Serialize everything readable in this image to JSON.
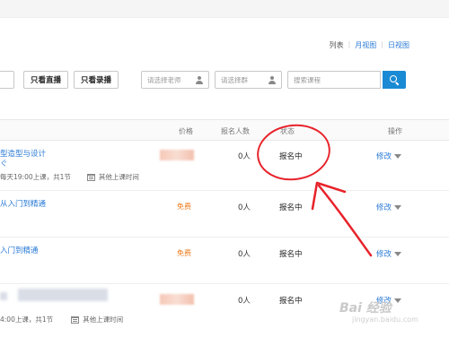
{
  "view": {
    "list": "列表",
    "month": "月视图",
    "day": "日视图"
  },
  "filters": {
    "edge_label": "",
    "live_only": "只看直播",
    "recorded_only": "只看录播",
    "teacher_placeholder": "请选择老师",
    "group_placeholder": "请选择群",
    "search_placeholder": "搜索课程"
  },
  "table": {
    "headers": {
      "price": "价格",
      "enrolled": "报名人数",
      "status": "状态",
      "actions": "操作"
    },
    "rows": [
      {
        "title": "型造型与设计",
        "title_tail": "ぐ",
        "schedule": "每天19:00上课，共1节",
        "other_time": "其他上课时间",
        "price": "",
        "count": "0人",
        "status": "报名中",
        "action": "修改"
      },
      {
        "title": "从入门到精通",
        "price": "免费",
        "count": "0人",
        "status": "报名中",
        "action": "修改"
      },
      {
        "title": "入门到精通",
        "price": "免费",
        "count": "0人",
        "status": "报名中",
        "action": "修改"
      },
      {
        "title": "",
        "schedule": "4:00上课，共1节",
        "other_time": "其他上课时间",
        "price": "",
        "count": "0人",
        "status": "报名中",
        "action": "修改"
      }
    ]
  },
  "watermark": {
    "logo": "Bai 经验",
    "url": "jingyan.baidu.com"
  },
  "colors": {
    "accent": "#2b7bd6",
    "search_button": "#1a8ad4",
    "free": "#f07a1a",
    "annotation": "#e8222a"
  }
}
